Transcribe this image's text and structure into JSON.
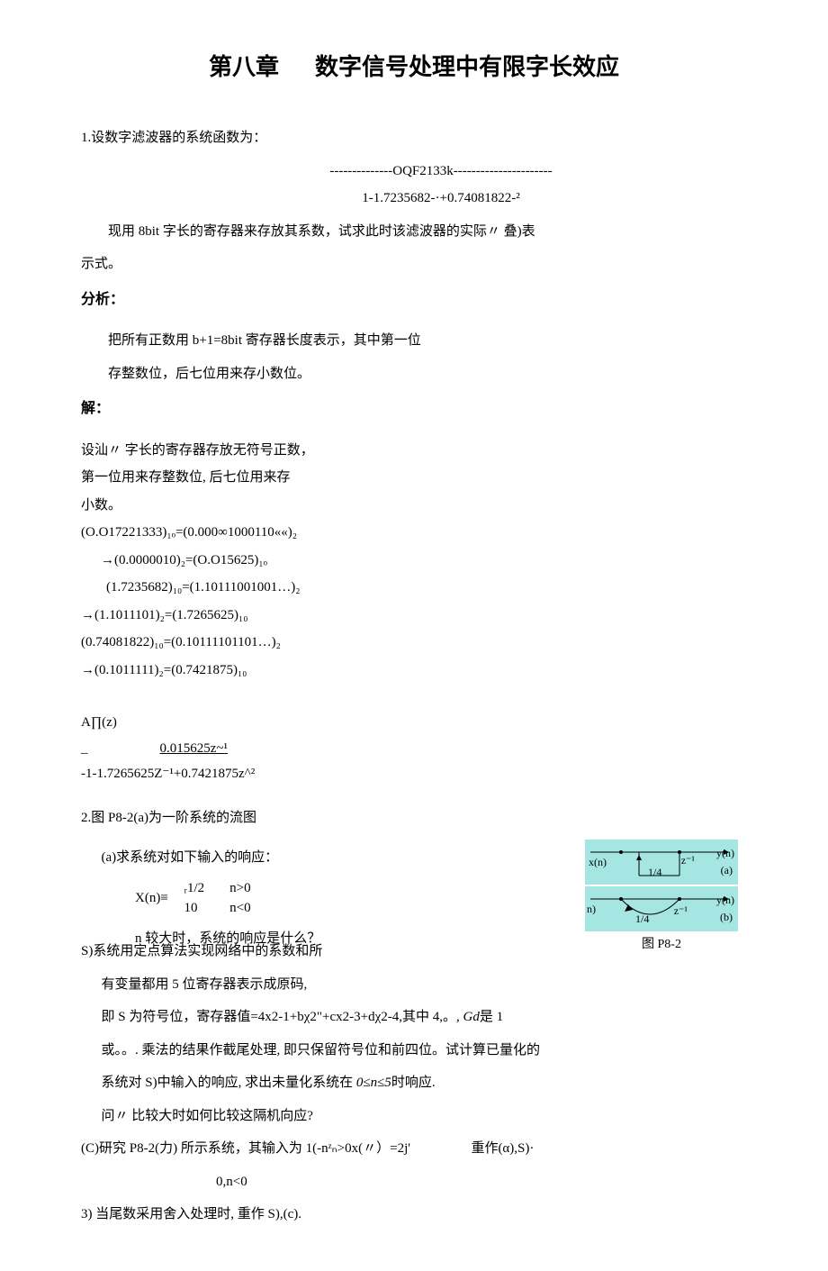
{
  "title_left": "第八章",
  "title_right": "数字信号处理中有限字长效应",
  "q1": {
    "intro": "1.设数字滤波器的系统函数为：",
    "eq_num_dashes": "--------------OQF2133k----------------------",
    "eq_den": "1-1.7235682-·+0.74081822-²",
    "desc": "现用 8bit 字长的寄存器来存放其系数，试求此时该滤波器的实际〃 叠)表",
    "desc2": "示式。",
    "analysis_head": "分析：",
    "analysis_l1": "把所有正数用 b+1=8bit 寄存器长度表示，其中第一位",
    "analysis_l2": "存整数位，后七位用来存小数位。",
    "solve_head": "解：",
    "s1": "设汕〃 字长的寄存器存放无符号正数，",
    "s2": "第一位用来存整数位, 后七位用来存",
    "s3": "小数。",
    "c1": "(O.O17221333)₁ₒ=(0.000∞1000110««)₂",
    "c2": "→(0.0000010)₂=(O.O15625)₁ₒ",
    "c3": "(1.7235682)₁₀=(1.10111001001…)₂",
    "c4": "→(1.1011101)₂=(1.7265625)₁₀",
    "c5": "(0.74081822)₁₀=(0.10111101101…)₂",
    "c6": "→(0.1011111)₂=(0.7421875)₁₀",
    "hz_head": "A∏(z)",
    "hz_num": "0.015625z~¹",
    "hz_den": "-1-1.7265625Z⁻¹+0.7421875z^²"
  },
  "q2": {
    "intro": "2.图 P8-2(a)为一阶系统的流图",
    "a_head": "(a)求系统对如下输入的响应：",
    "xn_label": "X(n)≡",
    "xn_r1c1": "ᵣ1/2",
    "xn_r1c2": "n>0",
    "xn_r2c1": "10",
    "xn_r2c2": "n<0",
    "a_tail": "n 较大时，系统的响应是什么？",
    "fig_cap": "图 P8-2",
    "diag_a": {
      "xn": "x(n)",
      "yn": "y(n)",
      "frac": "1/4",
      "z": "z⁻¹",
      "lab": "(a)"
    },
    "diag_b": {
      "left": "n)",
      "yn": "y(n)",
      "frac": "1/4",
      "z": "z⁻¹",
      "lab": "(b)"
    },
    "b_l1": "S)系统用定点算法实现网络中的系数和所",
    "b_l2": "有变量都用 5 位寄存器表示成原码,",
    "b_l3_a": "即 S 为符号位，寄存器值=4x2-1+bχ2\"+cx2-3+dχ2-4,其中 4,。, ",
    "b_l3_b": "Gd",
    "b_l3_c": "是 1",
    "b_l4": "或。。. 乘法的结果作截尾处理, 即只保留符号位和前四位。试计算已量化的",
    "b_l5_a": "系统对 S)中输入的响应, 求出未量化系统在 ",
    "b_l5_b": "0≤n≤5",
    "b_l5_c": "时响应.",
    "b_l6": "问〃 比较大时如何比较这隔机向应?",
    "c_l1_a": "(C)研究 P8-2(力) 所示系统，其输入为 1(-nᶻₙ>0x(〃）=2j'",
    "c_l1_b": "重作(α),S)·",
    "c_l2": "0,n<0",
    "d_l1": "3) 当尾数采用舍入处理时, 重作 S),(c)."
  }
}
